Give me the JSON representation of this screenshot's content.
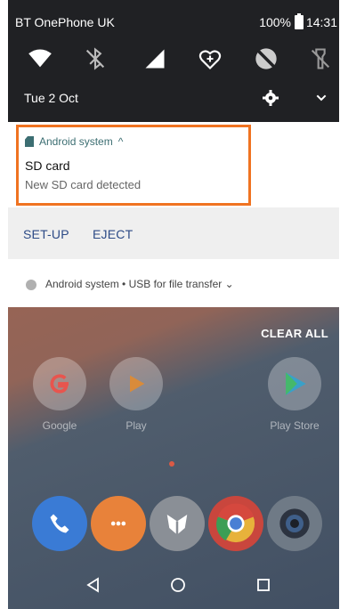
{
  "status_bar": {
    "carrier": "BT OnePhone UK",
    "battery": "100%",
    "time": "14:31"
  },
  "quick_settings": {
    "tiles": [
      "wifi-icon",
      "bluetooth-off-icon",
      "signal-icon",
      "heart-plus-icon",
      "do-not-disturb-icon",
      "flashlight-off-icon"
    ],
    "date": "Tue 2 Oct"
  },
  "notification": {
    "app_name": "Android system",
    "expand_glyph": "^",
    "title": "SD card",
    "text": "New SD card detected",
    "actions": [
      "SET-UP",
      "EJECT"
    ]
  },
  "usb_notification": {
    "text": "Android system • USB for file transfer",
    "chevron": "⌄"
  },
  "home": {
    "clear_all": "CLEAR ALL",
    "apps": [
      {
        "label": "Google"
      },
      {
        "label": "Play"
      },
      {
        "label": "Play Store"
      }
    ],
    "dock": [
      "phone-icon",
      "messages-icon",
      "fox-icon",
      "chrome-icon",
      "camera-icon"
    ]
  },
  "colors": {
    "highlight": "#f07321",
    "accent_text": "#2c4a86",
    "app_name": "#3c6e72"
  }
}
